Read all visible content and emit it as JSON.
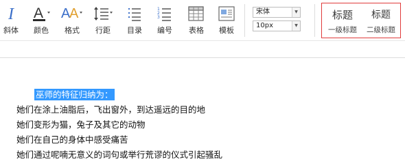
{
  "toolbar": {
    "buttons": [
      {
        "label": "斜体",
        "icon": "italic-icon"
      },
      {
        "label": "颜色",
        "icon": "font-color-icon"
      },
      {
        "label": "格式",
        "icon": "format-icon"
      },
      {
        "label": "行距",
        "icon": "line-spacing-icon"
      },
      {
        "label": "目录",
        "icon": "bullet-list-icon"
      },
      {
        "label": "编号",
        "icon": "numbered-list-icon"
      },
      {
        "label": "表格",
        "icon": "table-icon"
      },
      {
        "label": "模板",
        "icon": "template-icon"
      }
    ],
    "font_family": "宋体",
    "font_size": "10px"
  },
  "heading_styles": {
    "h1_preview": "标题",
    "h1_label": "一级标题",
    "h2_preview": "标题",
    "h2_label": "二级标题"
  },
  "document": {
    "selected_text": "巫师的特征归纳为：",
    "lines": [
      "她们在涂上油脂后，飞出窗外，到达遥远的目的地",
      "她们变形为猫，兔子及其它的动物",
      "她们在自己的身体中感受痛苦",
      "她们通过呢喃无意义的词句或举行荒谬的仪式引起骚乱"
    ]
  },
  "colors": {
    "accent": "#3b6fc9",
    "selection": "#3399ff",
    "heading_panel_border": "#e03a3a"
  }
}
